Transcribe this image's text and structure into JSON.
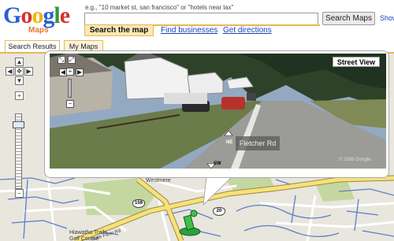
{
  "header": {
    "logo_letters": [
      "G",
      "o",
      "o",
      "g",
      "l",
      "e"
    ],
    "logo_colors": [
      "#2c5fd4",
      "#d6322a",
      "#f2b50f",
      "#2c5fd4",
      "#2f9a3e",
      "#d6322a"
    ],
    "logo_sub": "Maps",
    "search_hint": "e.g., \"10 market st, san francisco\" or \"hotels near lax\"",
    "search_value": "",
    "search_button": "Search Maps",
    "show_link": "Show",
    "tabs": {
      "active": "Search the map",
      "find_businesses": "Find businesses",
      "get_directions": "Get directions"
    }
  },
  "panel_tabs": [
    "Search Results",
    "My Maps"
  ],
  "street_view": {
    "label": "Street View",
    "street_name": "Fletcher Rd",
    "dir_ne": "NE",
    "dir_sw": "SW",
    "copyright": "© 2008 Google"
  },
  "map": {
    "labels": {
      "westmere": "Westmere",
      "golf": "Hiawatha Trails\nGolf Course",
      "state_farm": "State Farm Rd",
      "fletcher": "Fletcher Rd",
      "hwy_159": "159",
      "hwy_20": "20"
    }
  },
  "colors": {
    "accent": "#e7b854",
    "link": "#1a3fbf",
    "road_major": "#f7e17a",
    "road_minor": "#ffffff",
    "road_blue": "#5d7ec9",
    "park": "#c5d7a0"
  },
  "icons": [
    "pan-up-icon",
    "pan-left-icon",
    "pan-right-icon",
    "pan-down-icon",
    "zoom-in-icon",
    "zoom-out-icon",
    "pegman-icon"
  ]
}
